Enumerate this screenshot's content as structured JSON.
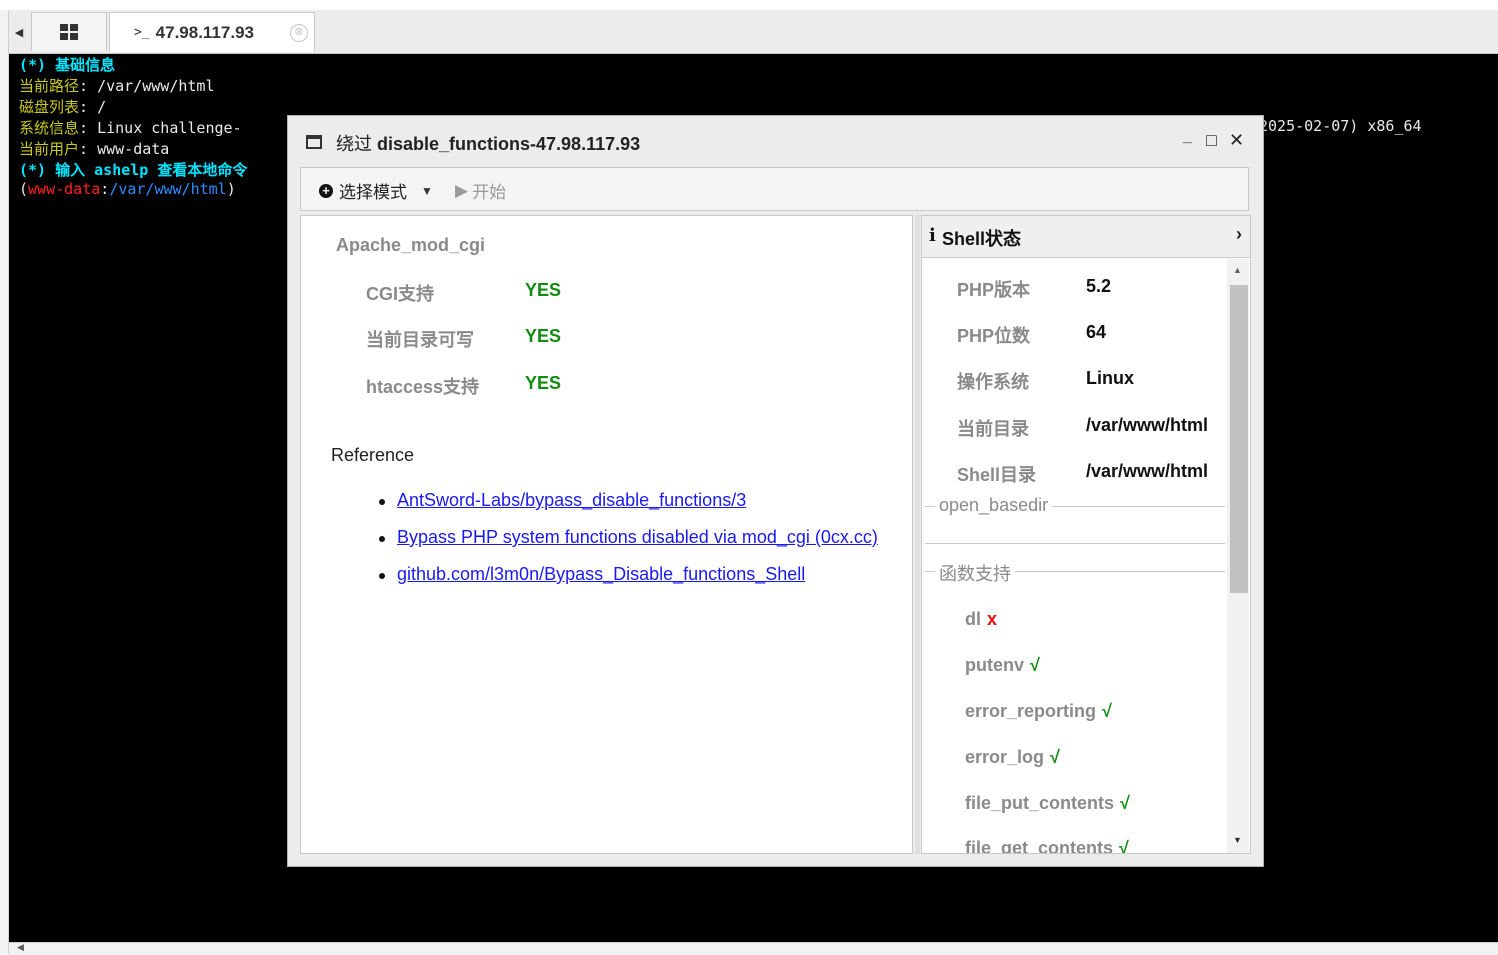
{
  "tabs": {
    "grid_icon": "grid-icon",
    "terminal_prompt": ">_",
    "terminal_label": "47.98.117.93",
    "close_symbol": "⊗"
  },
  "terminal": {
    "line1_tag": "(*)",
    "line1_text": "基础信息",
    "line2_key": "当前路径",
    "line2_val": ": /var/www/html",
    "line3_key": "磁盘列表",
    "line3_val": ": /",
    "line4_key": "系统信息",
    "line4_val": ": Linux challenge-",
    "line4_tail": "2025-02-07) x86_64",
    "line5_key": "当前用户",
    "line5_val": ": www-data",
    "line6_tag": "(*)",
    "line6_text": "输入 ashelp 查看本地命令",
    "prompt_open": "(",
    "prompt_user": "www-data",
    "prompt_sep": ":",
    "prompt_path": "/var/www/html",
    "prompt_close": ")"
  },
  "dialog": {
    "title_prefix": "绕过",
    "title_rest": " disable_functions-47.98.117.93",
    "minimize": "_",
    "maximize": "□",
    "close": "✕",
    "toolbar": {
      "select_mode": "选择模式",
      "start": "开始"
    },
    "left": {
      "title": "Apache_mod_cgi",
      "rows": [
        {
          "label": "CGI支持",
          "value": "YES"
        },
        {
          "label": "当前目录可写",
          "value": "YES"
        },
        {
          "label": "htaccess支持",
          "value": "YES"
        }
      ],
      "reference_title": "Reference",
      "references": [
        "AntSword-Labs/bypass_disable_functions/3",
        "Bypass PHP system functions disabled via mod_cgi (0cx.cc)",
        "github.com/l3m0n/Bypass_Disable_functions_Shell"
      ]
    },
    "right": {
      "header": "Shell状态",
      "info": [
        {
          "key": "PHP版本",
          "value": "5.2"
        },
        {
          "key": "PHP位数",
          "value": "64"
        },
        {
          "key": "操作系统",
          "value": "Linux"
        },
        {
          "key": "当前目录",
          "value": "/var/www/html"
        },
        {
          "key": "Shell目录",
          "value": "/var/www/html"
        }
      ],
      "open_basedir_legend": "open_basedir",
      "functions_legend": "函数支持",
      "functions": [
        {
          "name": "dl",
          "mark": "x"
        },
        {
          "name": "putenv",
          "mark": "√"
        },
        {
          "name": "error_reporting",
          "mark": "√"
        },
        {
          "name": "error_log",
          "mark": "√"
        },
        {
          "name": "file_put_contents",
          "mark": "√"
        },
        {
          "name": "file_get_contents",
          "mark": "√"
        }
      ]
    }
  }
}
